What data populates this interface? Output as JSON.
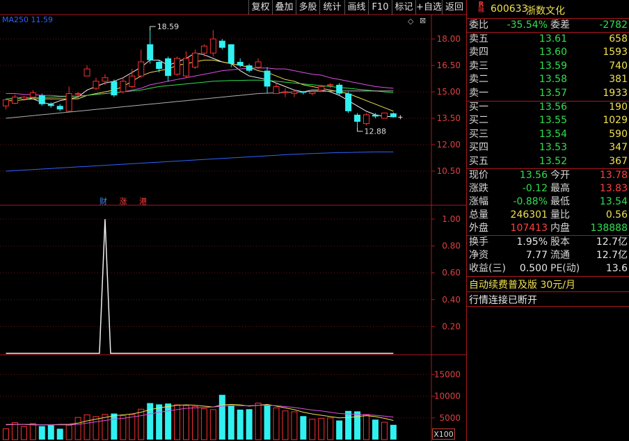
{
  "toolbar": {
    "buttons": [
      "复权",
      "叠加",
      "多股",
      "统计",
      "画线",
      "F10",
      "标记",
      "+自选",
      "返回"
    ]
  },
  "chart": {
    "ma_label": "MA250",
    "ma_value": "11.59",
    "ma_color": "#2f63ff",
    "price_ticks": [
      "18.00",
      "16.50",
      "15.00",
      "13.50",
      "12.00",
      "10.50"
    ],
    "indicator_ticks": [
      "1.00",
      "0.80",
      "0.60",
      "0.40",
      "0.20"
    ],
    "volume_ticks": [
      "15000",
      "10000",
      "5000"
    ],
    "volume_unit": "X100",
    "high_marker": "18.59",
    "low_marker": "12.88",
    "news_marks": [
      "财",
      "涨",
      "港"
    ],
    "up_color": "#ff3030",
    "down_color": "#30f0f0",
    "candles": [
      [
        14.2,
        14.55,
        14.0,
        14.6
      ],
      [
        14.35,
        14.7,
        14.3,
        14.85
      ],
      [
        14.6,
        14.7,
        14.5,
        14.75
      ],
      [
        14.7,
        14.95,
        14.6,
        15.1
      ],
      [
        14.8,
        14.3,
        14.2,
        14.9
      ],
      [
        14.3,
        14.2,
        14.1,
        14.4
      ],
      [
        14.2,
        14.0,
        13.9,
        14.3
      ],
      [
        13.9,
        14.9,
        13.9,
        15.3
      ],
      [
        14.9,
        14.9,
        14.7,
        15.0
      ],
      [
        15.9,
        16.3,
        15.9,
        16.5
      ],
      [
        15.2,
        15.6,
        15.1,
        15.8
      ],
      [
        15.6,
        15.8,
        15.4,
        16.0
      ],
      [
        15.6,
        14.8,
        14.7,
        15.7
      ],
      [
        15.0,
        15.6,
        14.9,
        15.8
      ],
      [
        15.3,
        15.9,
        15.2,
        16.3
      ],
      [
        15.9,
        16.7,
        15.8,
        17.4
      ],
      [
        17.7,
        16.8,
        16.6,
        18.59
      ],
      [
        16.7,
        16.3,
        16.1,
        16.8
      ],
      [
        16.9,
        15.9,
        15.6,
        17.0
      ],
      [
        16.0,
        16.9,
        15.9,
        17.0
      ],
      [
        15.9,
        16.9,
        15.8,
        17.3
      ],
      [
        16.4,
        17.2,
        16.3,
        17.4
      ],
      [
        17.2,
        17.6,
        17.0,
        17.7
      ],
      [
        17.2,
        18.0,
        17.0,
        18.5
      ],
      [
        17.9,
        17.5,
        17.4,
        18.0
      ],
      [
        17.7,
        16.6,
        16.4,
        17.7
      ],
      [
        16.7,
        16.5,
        16.4,
        16.9
      ],
      [
        16.5,
        16.2,
        16.1,
        16.6
      ],
      [
        16.4,
        16.7,
        16.3,
        16.9
      ],
      [
        16.2,
        15.3,
        14.9,
        16.4
      ],
      [
        14.9,
        15.3,
        14.9,
        15.5
      ],
      [
        15.0,
        15.0,
        14.7,
        15.2
      ],
      [
        14.9,
        15.0,
        14.7,
        15.1
      ],
      [
        15.0,
        14.95,
        14.85,
        15.05
      ],
      [
        14.9,
        15.0,
        14.8,
        15.0
      ],
      [
        15.1,
        15.3,
        15.0,
        15.4
      ],
      [
        15.4,
        15.4,
        15.2,
        15.5
      ],
      [
        15.4,
        14.9,
        14.8,
        15.5
      ],
      [
        14.9,
        13.9,
        13.8,
        15.0
      ],
      [
        13.7,
        13.3,
        12.88,
        13.8
      ],
      [
        13.2,
        13.7,
        13.1,
        13.8
      ],
      [
        13.7,
        13.6,
        13.5,
        13.8
      ],
      [
        13.5,
        13.8,
        13.5,
        13.8
      ],
      [
        13.78,
        13.56,
        13.54,
        13.83
      ]
    ],
    "volumes": [
      2500,
      3900,
      3000,
      3700,
      3100,
      3300,
      2500,
      3300,
      5100,
      5700,
      5300,
      5800,
      6000,
      5500,
      5800,
      7000,
      8400,
      8100,
      8300,
      8000,
      7800,
      7600,
      7100,
      6900,
      10300,
      7900,
      6900,
      7000,
      8400,
      7900,
      7300,
      6600,
      6400,
      5400,
      4700,
      4900,
      5000,
      4400,
      6600,
      6500,
      5800,
      4600,
      4000,
      3400
    ],
    "ma_lines": {
      "ma5": {
        "color": "#f0f0f0",
        "values": [
          14.6,
          14.6,
          14.7,
          14.6,
          14.4,
          14.3,
          14.5,
          14.6,
          14.7,
          15.1,
          15.3,
          15.5,
          15.6,
          15.8,
          16.1,
          16.4,
          16.8,
          16.8,
          16.5,
          16.7,
          16.9,
          17.2,
          17.1,
          16.9,
          16.7,
          16.6,
          16.2,
          15.9,
          15.8,
          15.7,
          15.5,
          15.3,
          15.1,
          15.0,
          15.1,
          15.1,
          15.0,
          14.8,
          14.5,
          14.2,
          13.9,
          13.7,
          13.6,
          13.6
        ]
      },
      "ma10": {
        "color": "#f0e050",
        "values": [
          14.5,
          14.5,
          14.55,
          14.6,
          14.6,
          14.6,
          14.6,
          14.6,
          14.6,
          14.8,
          14.9,
          15.0,
          15.1,
          15.3,
          15.6,
          15.9,
          16.1,
          16.2,
          16.3,
          16.5,
          16.6,
          16.7,
          16.8,
          16.8,
          16.7,
          16.6,
          16.5,
          16.4,
          16.2,
          16.1,
          15.9,
          15.7,
          15.6,
          15.4,
          15.3,
          15.2,
          15.1,
          15.0,
          14.9,
          14.7,
          14.5,
          14.3,
          14.1,
          13.9
        ]
      },
      "ma20": {
        "color": "#e050e0",
        "values": [
          14.9,
          14.9,
          14.85,
          14.85,
          14.8,
          14.8,
          14.75,
          14.75,
          14.75,
          14.8,
          14.85,
          14.9,
          14.95,
          15.0,
          15.1,
          15.2,
          15.4,
          15.5,
          15.6,
          15.7,
          15.8,
          15.9,
          16.0,
          16.1,
          16.2,
          16.25,
          16.3,
          16.35,
          16.35,
          16.35,
          16.3,
          16.3,
          16.2,
          16.1,
          16.0,
          15.95,
          15.8,
          15.7,
          15.6,
          15.5,
          15.4,
          15.3,
          15.25,
          15.2
        ]
      },
      "ma60": {
        "color": "#30e050",
        "values": [
          14.6,
          14.62,
          14.64,
          14.66,
          14.68,
          14.7,
          14.72,
          14.74,
          14.76,
          14.8,
          14.85,
          14.9,
          14.95,
          15.0,
          15.05,
          15.1,
          15.2,
          15.3,
          15.35,
          15.4,
          15.45,
          15.5,
          15.55,
          15.6,
          15.62,
          15.64,
          15.65,
          15.66,
          15.66,
          15.65,
          15.6,
          15.55,
          15.5,
          15.45,
          15.4,
          15.35,
          15.3,
          15.25,
          15.2,
          15.15,
          15.1,
          15.05,
          15.0,
          14.95
        ]
      },
      "ma120": {
        "color": "#b0b0b0",
        "values": [
          13.5,
          13.55,
          13.6,
          13.65,
          13.7,
          13.75,
          13.8,
          13.85,
          13.9,
          13.95,
          14.0,
          14.05,
          14.1,
          14.15,
          14.2,
          14.25,
          14.3,
          14.35,
          14.4,
          14.45,
          14.5,
          14.55,
          14.6,
          14.65,
          14.7,
          14.75,
          14.8,
          14.85,
          14.9,
          14.92,
          14.94,
          14.96,
          14.98,
          15.0,
          15.02,
          15.03,
          15.04,
          15.05,
          15.05,
          15.05,
          15.05,
          15.05,
          15.05,
          15.05
        ]
      },
      "ma250": {
        "color": "#2f63ff",
        "values": [
          10.5,
          10.53,
          10.56,
          10.59,
          10.62,
          10.65,
          10.68,
          10.71,
          10.74,
          10.77,
          10.8,
          10.83,
          10.86,
          10.89,
          10.92,
          10.95,
          10.98,
          11.01,
          11.04,
          11.07,
          11.1,
          11.13,
          11.16,
          11.19,
          11.22,
          11.25,
          11.28,
          11.31,
          11.34,
          11.37,
          11.4,
          11.43,
          11.46,
          11.48,
          11.5,
          11.52,
          11.54,
          11.55,
          11.56,
          11.57,
          11.58,
          11.59,
          11.59,
          11.59
        ]
      }
    },
    "vol_ma": {
      "yellow": {
        "color": "#f0e050",
        "values": [
          3400,
          3500,
          3500,
          3400,
          3400,
          3400,
          3500,
          3500,
          3800,
          4300,
          4700,
          5100,
          5500,
          5700,
          5900,
          6300,
          6900,
          7300,
          7600,
          7900,
          8000,
          7900,
          7700,
          7500,
          8000,
          8100,
          8000,
          7700,
          7900,
          8100,
          7700,
          7300,
          6900,
          6300,
          5900,
          5600,
          5300,
          5000,
          5100,
          5300,
          5500,
          5300,
          4900,
          4400
        ]
      },
      "magenta": {
        "color": "#e050e0",
        "values": [
          3500,
          3500,
          3500,
          3500,
          3400,
          3400,
          3400,
          3400,
          3500,
          3800,
          4100,
          4400,
          4700,
          4900,
          5200,
          5500,
          5900,
          6300,
          6600,
          6900,
          7200,
          7300,
          7400,
          7500,
          7700,
          7800,
          7800,
          7800,
          7900,
          7900,
          7800,
          7600,
          7400,
          7100,
          6800,
          6600,
          6300,
          6000,
          5900,
          5800,
          5700,
          5600,
          5400,
          5200
        ]
      }
    },
    "indicator": [
      0,
      0,
      0,
      0,
      0,
      0,
      0,
      0,
      0,
      0,
      0,
      1.0,
      0,
      0,
      0,
      0,
      0,
      0,
      0,
      0,
      0,
      0,
      0,
      0,
      0,
      0,
      0,
      0,
      0,
      0,
      0,
      0,
      0,
      0,
      0,
      0,
      0,
      0,
      0,
      0,
      0,
      0,
      0,
      0
    ]
  },
  "quote": {
    "code": "600633",
    "name": "浙数文化",
    "badge_top": "R",
    "badge_bottom": "融",
    "webi_label": "委比",
    "webi_value": "-35.54%",
    "weicha_label": "委差",
    "weicha_value": "-2782",
    "asks": [
      {
        "label": "卖五",
        "price": "13.61",
        "vol": "658"
      },
      {
        "label": "卖四",
        "price": "13.60",
        "vol": "1593"
      },
      {
        "label": "卖三",
        "price": "13.59",
        "vol": "740"
      },
      {
        "label": "卖二",
        "price": "13.58",
        "vol": "381"
      },
      {
        "label": "卖一",
        "price": "13.57",
        "vol": "1933"
      }
    ],
    "bids": [
      {
        "label": "买一",
        "price": "13.56",
        "vol": "190"
      },
      {
        "label": "买二",
        "price": "13.55",
        "vol": "1029"
      },
      {
        "label": "买三",
        "price": "13.54",
        "vol": "590"
      },
      {
        "label": "买四",
        "price": "13.53",
        "vol": "347"
      },
      {
        "label": "买五",
        "price": "13.52",
        "vol": "367"
      }
    ],
    "stats": [
      {
        "l1": "现价",
        "v1": "13.56",
        "c1": "green",
        "l2": "今开",
        "v2": "13.78",
        "c2": "red"
      },
      {
        "l1": "涨跌",
        "v1": "-0.12",
        "c1": "green",
        "l2": "最高",
        "v2": "13.83",
        "c2": "red"
      },
      {
        "l1": "涨幅",
        "v1": "-0.88%",
        "c1": "green",
        "l2": "最低",
        "v2": "13.54",
        "c2": "green"
      },
      {
        "l1": "总量",
        "v1": "246301",
        "c1": "yel",
        "l2": "量比",
        "v2": "0.56",
        "c2": "yel"
      },
      {
        "l1": "外盘",
        "v1": "107413",
        "c1": "red",
        "l2": "内盘",
        "v2": "138888",
        "c2": "green"
      }
    ],
    "fund": [
      {
        "l1": "换手",
        "v1": "1.95%",
        "l2": "股本",
        "v2": "12.7亿"
      },
      {
        "l1": "净资",
        "v1": "7.77",
        "l2": "流通",
        "v2": "12.7亿"
      },
      {
        "l1": "收益(三)",
        "v1": "0.500",
        "l2": "PE(动)",
        "v2": "13.6"
      }
    ],
    "plan_text": "自动续费普及版  30元/月",
    "conn_text": "行情连接已断开"
  }
}
